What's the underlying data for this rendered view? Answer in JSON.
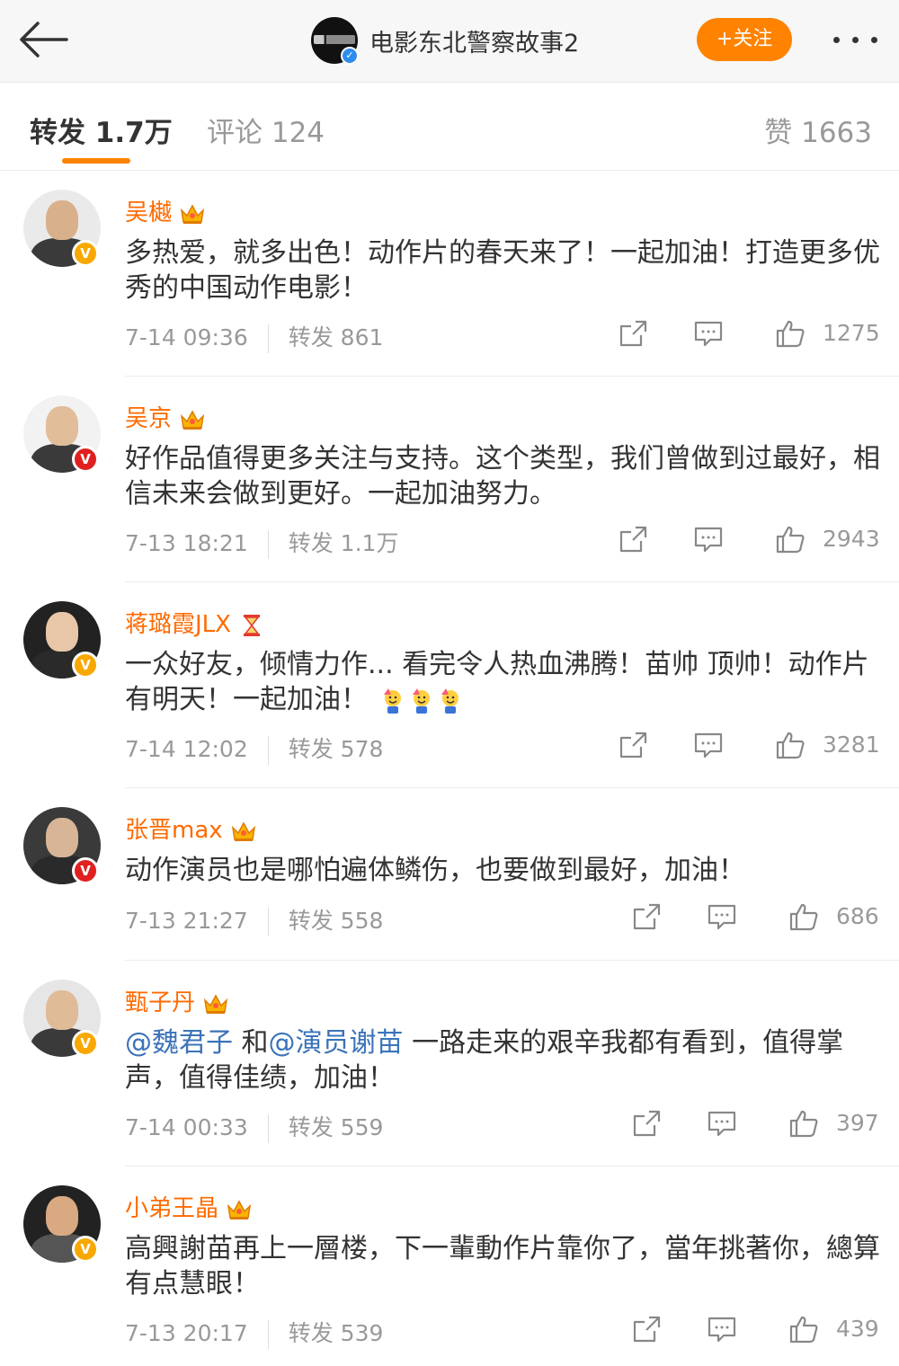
{
  "header": {
    "account_name": "电影东北警察故事2",
    "follow_label": "+关注",
    "icons": {
      "back": "back-arrow-icon",
      "more": "more-dots-icon",
      "verified": "verified-icon"
    },
    "accent_color": "#ff8200"
  },
  "tabs": {
    "repost": "转发 1.7万",
    "comment": "评论 124",
    "like": "赞 1663"
  },
  "reposts": [
    {
      "name": "吴樾",
      "text": "多热爱，就多出色！动作片的春天来了！一起加油！打造更多优秀的中国动作电影！",
      "time": "7-14 09:36",
      "repost": "转发 861",
      "likes": "1275",
      "badge": "gold",
      "name_icon": "crown-icon"
    },
    {
      "name": "吴京",
      "text": "好作品值得更多关注与支持。这个类型，我们曾做到过最好，相信未来会做到更好。一起加油努力。",
      "time": "7-13 18:21",
      "repost": "转发 1.1万",
      "likes": "2943",
      "badge": "red",
      "name_icon": "crown-icon"
    },
    {
      "name": "蒋璐霞JLX",
      "text": "一众好友，倾情力作... 看完令人热血沸腾！苗帅 顶帅！动作片有明天！一起加油！",
      "time": "7-14 12:02",
      "repost": "转发 578",
      "likes": "3281",
      "badge": "gold",
      "name_icon": "hourglass-icon"
    },
    {
      "name": "张晋max",
      "text": "动作演员也是哪怕遍体鳞伤，也要做到最好，加油！",
      "time": "7-13 21:27",
      "repost": "转发 558",
      "likes": "686",
      "badge": "red",
      "name_icon": "crown-icon"
    },
    {
      "name": "甄子丹",
      "mention1": "@魏君子",
      "connector": " 和",
      "mention2": "@演员谢苗",
      "text": " 一路走来的艰辛我都有看到，值得掌声，值得佳绩，加油！",
      "time": "7-14 00:33",
      "repost": "转发 559",
      "likes": "397",
      "badge": "gold",
      "name_icon": "crown-icon"
    },
    {
      "name": "小弟王晶",
      "text": "高興謝苗再上一層楼，下一輩動作片靠你了，當年挑著你，總算有点慧眼！",
      "time": "7-13 20:17",
      "repost": "转发 539",
      "likes": "439",
      "badge": "gold",
      "name_icon": "crown-icon"
    }
  ]
}
